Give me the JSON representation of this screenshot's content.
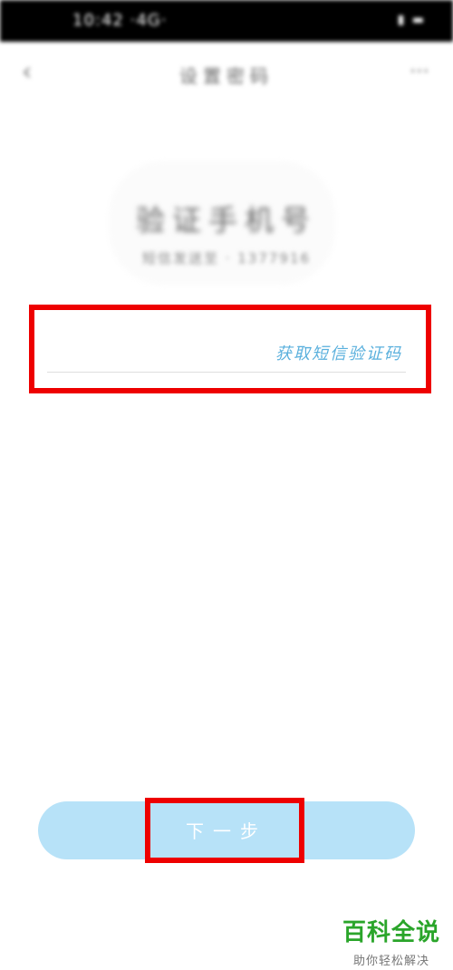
{
  "status_bar": {
    "time": "10:42 ·4G·",
    "icons": "▮ ▬"
  },
  "nav": {
    "back_glyph": "‹",
    "title": "设置密码",
    "menu_glyph": "⋯"
  },
  "header": {
    "title": "验证手机号",
    "subtitle": "短信发送至 · 1377916"
  },
  "code_input": {
    "value": "",
    "placeholder": ""
  },
  "get_code_label": "获取短信验证码",
  "next_button_label": "下一步",
  "watermark": {
    "title": "百科全说",
    "subtitle": "助你轻松解决"
  },
  "colors": {
    "accent": "#5ab0dd",
    "button_bg": "#b7e2f8",
    "highlight": "#ee0000",
    "watermark_green": "#2aa52a"
  }
}
